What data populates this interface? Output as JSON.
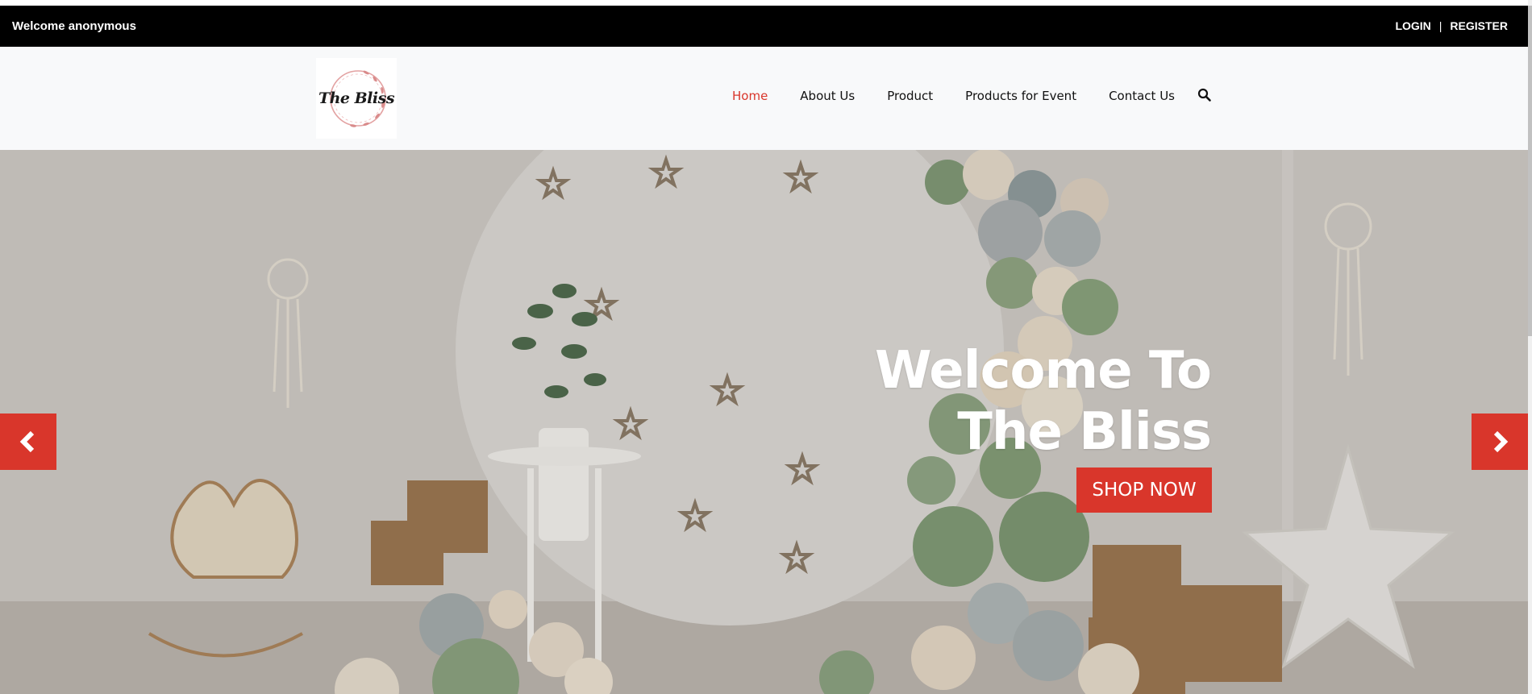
{
  "topbar": {
    "welcome": "Welcome anonymous",
    "login": "LOGIN",
    "separator": "|",
    "register": "REGISTER"
  },
  "header": {
    "logo_text": "The Bliss",
    "nav": [
      {
        "label": "Home",
        "active": true
      },
      {
        "label": "About Us",
        "active": false
      },
      {
        "label": "Product",
        "active": false
      },
      {
        "label": "Products for Event",
        "active": false
      },
      {
        "label": "Contact Us",
        "active": false
      }
    ],
    "search_icon": "search-icon"
  },
  "hero": {
    "title_line1": "Welcome To",
    "title_line2": "The Bliss",
    "cta": "SHOP NOW",
    "prev_icon": "chevron-left-icon",
    "next_icon": "chevron-right-icon"
  },
  "colors": {
    "accent": "#d9362b",
    "topbar_bg": "#000000",
    "navbar_bg": "#f8f9fa"
  }
}
